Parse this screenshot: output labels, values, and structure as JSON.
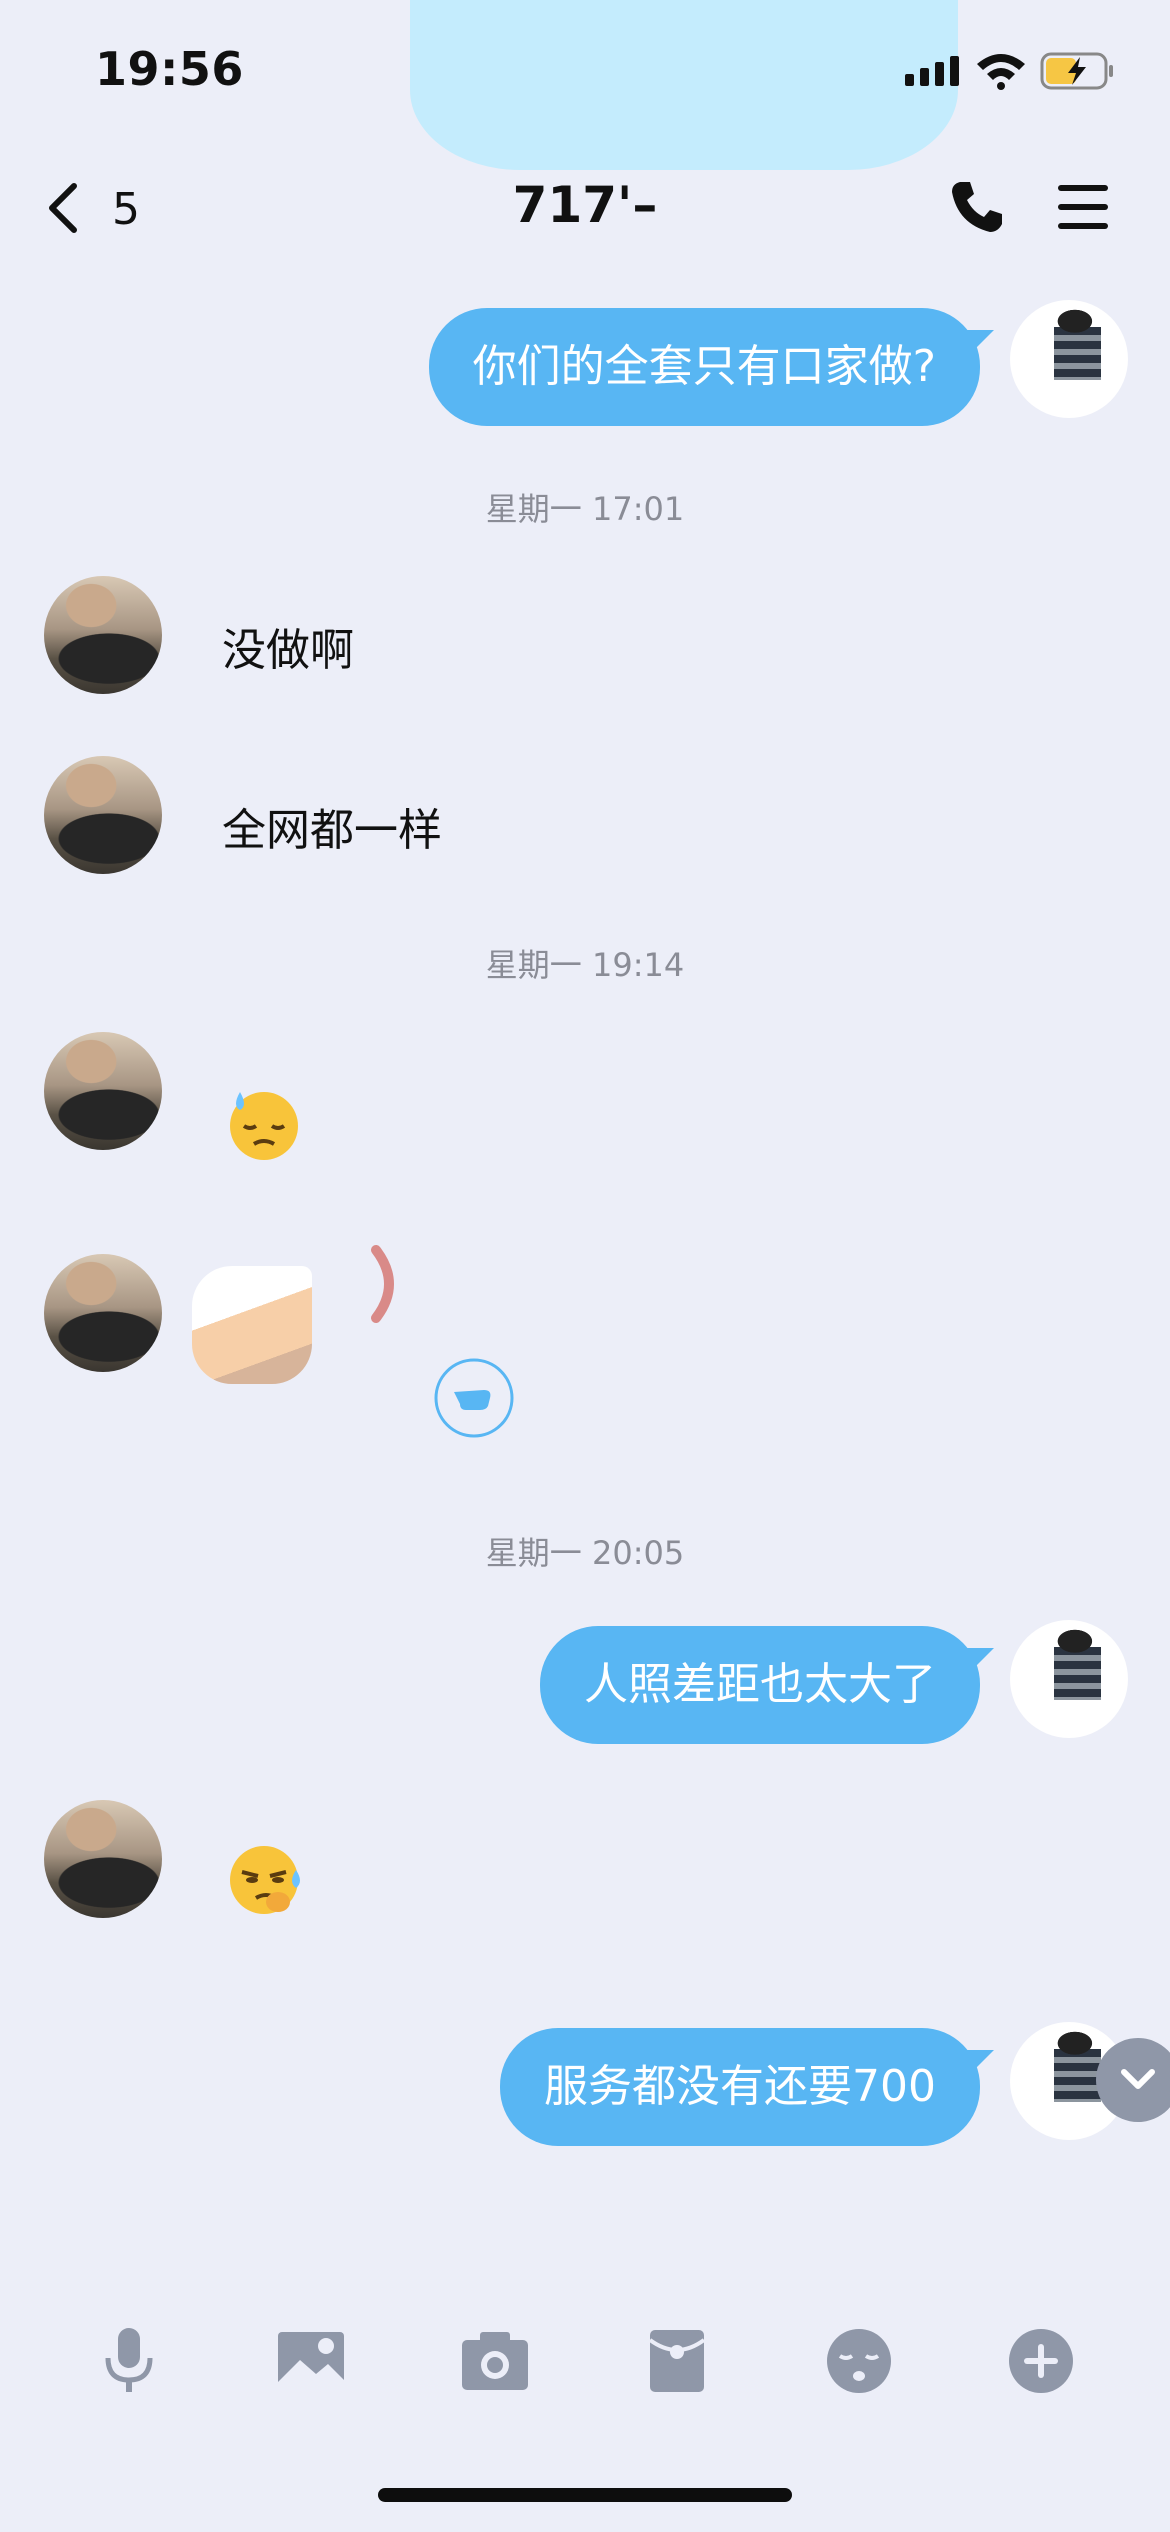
{
  "status_bar": {
    "time": "19:56"
  },
  "header": {
    "back_count": "5",
    "title": "717'–"
  },
  "messages": [
    {
      "dir": "out",
      "text": "你们的全套只有口家做?"
    },
    {
      "type": "timestamp",
      "text": "星期一 17:01"
    },
    {
      "dir": "in",
      "text": "没做啊"
    },
    {
      "dir": "in",
      "text": "全网都一样"
    },
    {
      "type": "timestamp",
      "text": "星期一 19:14"
    },
    {
      "dir": "in",
      "emoji": "sweat-face"
    },
    {
      "dir": "in",
      "sticker": "redacted-sticker"
    },
    {
      "type": "timestamp",
      "text": "星期一 20:05"
    },
    {
      "dir": "out",
      "text": "人照差距也太大了"
    },
    {
      "dir": "in",
      "emoji": "thinking-sweat-face"
    },
    {
      "dir": "out",
      "text": "服务都没有还要700"
    }
  ],
  "toolbar": {
    "items": [
      "microphone-icon",
      "image-icon",
      "camera-icon",
      "red-packet-icon",
      "emoji-icon",
      "plus-icon"
    ]
  },
  "colors": {
    "bubble_out": "#58b6f3",
    "background": "#eceef8",
    "toolbar_icon": "#8f97a8"
  }
}
